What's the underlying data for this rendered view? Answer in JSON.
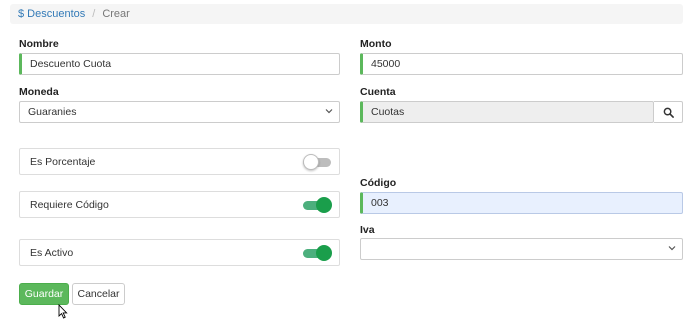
{
  "breadcrumb": {
    "link_label": "$ Descuentos",
    "separator": "/",
    "current": "Crear"
  },
  "form": {
    "nombre": {
      "label": "Nombre",
      "value": "Descuento Cuota"
    },
    "monto": {
      "label": "Monto",
      "value": "45000"
    },
    "moneda": {
      "label": "Moneda",
      "value": "Guaranies"
    },
    "cuenta": {
      "label": "Cuenta",
      "value": "Cuotas"
    },
    "es_porcentaje": {
      "label": "Es Porcentaje",
      "checked": false
    },
    "requiere_codigo": {
      "label": "Requiere Código",
      "checked": true
    },
    "es_activo": {
      "label": "Es Activo",
      "checked": true
    },
    "codigo": {
      "label": "Código",
      "value": "003"
    },
    "iva": {
      "label": "Iva",
      "value": ""
    }
  },
  "actions": {
    "save_label": "Guardar",
    "cancel_label": "Cancelar"
  },
  "colors": {
    "accent_green": "#5cb85c",
    "toggle_on": "#1a9e4b",
    "link_blue": "#337ab7"
  }
}
